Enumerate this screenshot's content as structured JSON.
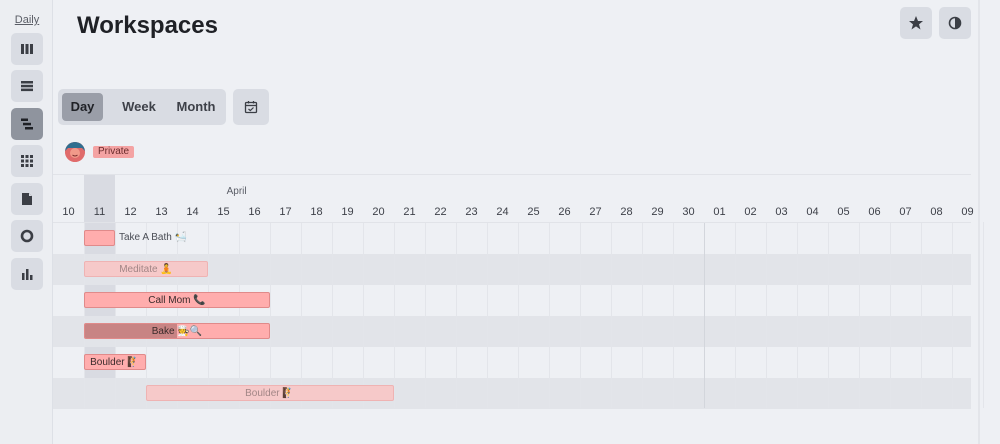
{
  "sidebar": {
    "title": "Daily",
    "items": [
      {
        "icon": "columns-icon",
        "active": false
      },
      {
        "icon": "list-icon",
        "active": false
      },
      {
        "icon": "timeline-icon",
        "active": true
      },
      {
        "icon": "grid-icon",
        "active": false
      },
      {
        "icon": "document-icon",
        "active": false
      },
      {
        "icon": "circle-icon",
        "active": false
      },
      {
        "icon": "bar-chart-icon",
        "active": false
      }
    ]
  },
  "header": {
    "title": "Workspaces",
    "favorite_icon": "star-icon",
    "theme_icon": "contrast-icon"
  },
  "view_switch": {
    "options": [
      "Day",
      "Week",
      "Month"
    ],
    "selected": "Day",
    "calendar_icon": "calendar-icon"
  },
  "owner": {
    "tag": "Private",
    "avatar_icon": "avatar-icon"
  },
  "timeline": {
    "month": "April",
    "days": [
      "10",
      "11",
      "12",
      "13",
      "14",
      "15",
      "16",
      "17",
      "18",
      "19",
      "20",
      "21",
      "22",
      "23",
      "24",
      "25",
      "26",
      "27",
      "28",
      "29",
      "30",
      "01",
      "02",
      "03",
      "04",
      "05",
      "06",
      "07",
      "08",
      "09"
    ],
    "today_index": 1,
    "tasks": [
      {
        "label": "Take A Bath",
        "emoji": "🛀",
        "start": 1,
        "end": 2,
        "style": "solid",
        "label_outside": true,
        "progress": 0
      },
      {
        "label": "Meditate",
        "emoji": "🧘",
        "start": 1,
        "end": 5,
        "style": "faded",
        "label_outside": false,
        "progress": 0
      },
      {
        "label": "Call Mom",
        "emoji": "📞",
        "start": 1,
        "end": 7,
        "style": "solid",
        "label_outside": false,
        "progress": 0
      },
      {
        "label": "Bake",
        "emoji": "🧑‍🍳🔍",
        "start": 1,
        "end": 7,
        "style": "solid",
        "label_outside": false,
        "progress": 0.5
      },
      {
        "label": "Boulder",
        "emoji": "🧗",
        "start": 1,
        "end": 3,
        "style": "solid",
        "label_outside": false,
        "progress": 0
      },
      {
        "label": "Boulder",
        "emoji": "🧗",
        "start": 3,
        "end": 11,
        "style": "faded",
        "label_outside": false,
        "progress": 0
      }
    ]
  },
  "colors": {
    "bar_solid": "#ffadad",
    "bar_faded": "#f6c9c9",
    "bar_progress": "#c88484",
    "today_column": "#d9dbe2"
  }
}
